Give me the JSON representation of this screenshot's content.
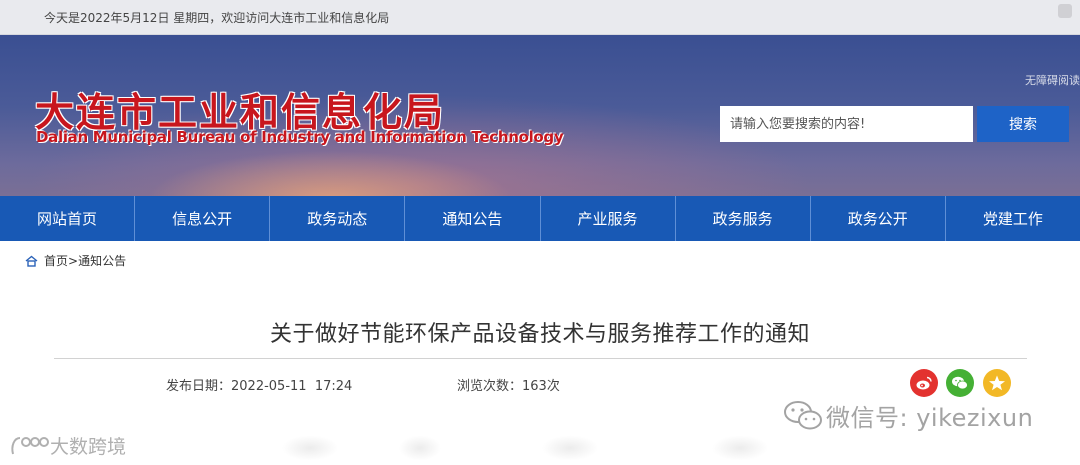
{
  "topbar": {
    "welcome_text": "今天是2022年5月12日 星期四，欢迎访问大连市工业和信息化局"
  },
  "header": {
    "logo_cn": "大连市工业和信息化局",
    "logo_en": "Dalian Municipal Bureau of Industry and Information Technology",
    "accessibility_label": "无障碍阅读",
    "search": {
      "placeholder": "请输入您要搜索的内容!",
      "button_label": "搜索"
    }
  },
  "nav": {
    "items": [
      {
        "label": "网站首页"
      },
      {
        "label": "信息公开"
      },
      {
        "label": "政务动态"
      },
      {
        "label": "通知公告"
      },
      {
        "label": "产业服务"
      },
      {
        "label": "政务服务"
      },
      {
        "label": "政务公开"
      },
      {
        "label": "党建工作"
      }
    ]
  },
  "breadcrumb": {
    "home": "首页",
    "separator": ">",
    "current": "通知公告"
  },
  "article": {
    "title": "关于做好节能环保产品设备技术与服务推荐工作的通知",
    "date_label": "发布日期：",
    "date_value": "2022-05-11  17:24",
    "views_label": "浏览次数：",
    "views_value": "163次"
  },
  "share_icons": [
    "weibo-icon",
    "wechat-icon",
    "qzone-icon"
  ],
  "watermarks": {
    "right": "微信号: yikezixun",
    "left": "大数跨境"
  },
  "colors": {
    "nav_bg": "#1859b5",
    "search_button": "#1e63c7",
    "logo_red": "#c8161d",
    "weibo": "#e3322f",
    "wechat": "#45b035",
    "qzone": "#f2b826"
  }
}
